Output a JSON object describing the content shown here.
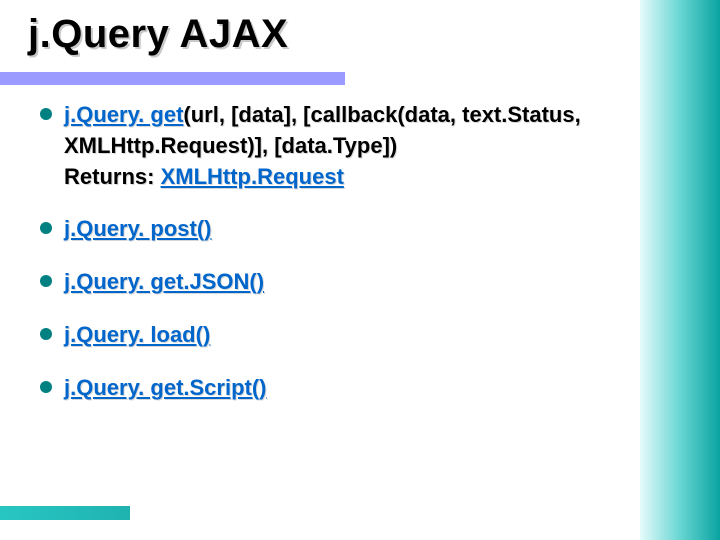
{
  "title": "j.Query AJAX",
  "items": [
    {
      "segments": [
        {
          "text": "j.Query. get",
          "link": true
        },
        {
          "text": "(url, [data], [callback(data, text.Status, XMLHttp.Request)], [data.Type])",
          "link": false
        },
        {
          "text": "\nReturns: ",
          "link": false,
          "break": true
        },
        {
          "text": "XMLHttp.Request",
          "link": true
        }
      ]
    },
    {
      "segments": [
        {
          "text": "j.Query. post()",
          "link": true
        }
      ]
    },
    {
      "segments": [
        {
          "text": "j.Query. get.JSON()",
          "link": true
        }
      ]
    },
    {
      "segments": [
        {
          "text": "j.Query. load()",
          "link": true
        }
      ]
    },
    {
      "segments": [
        {
          "text": "j.Query. get.Script()",
          "link": true
        }
      ]
    }
  ]
}
